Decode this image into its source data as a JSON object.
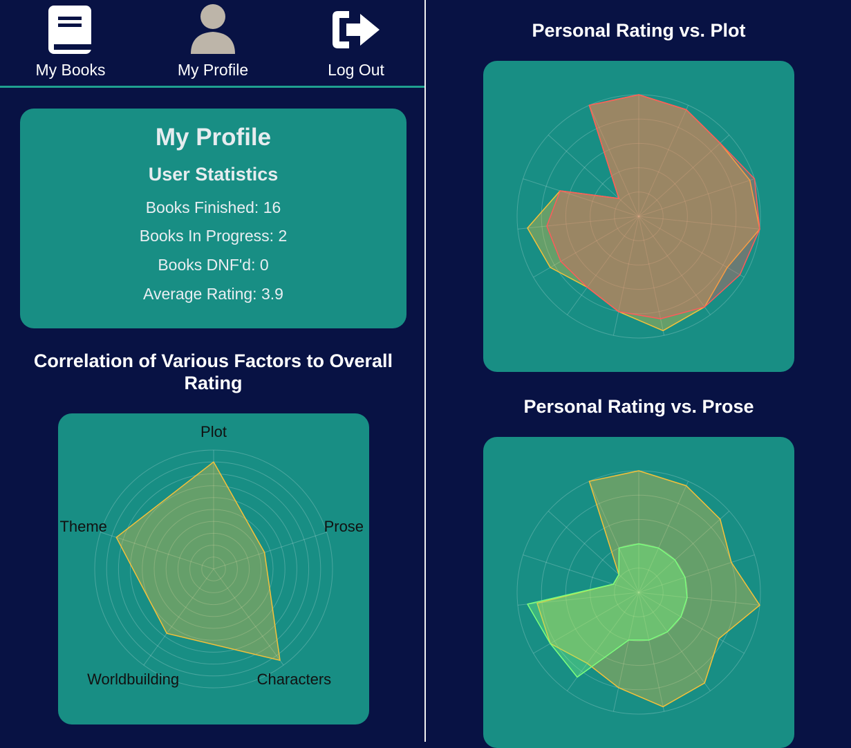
{
  "nav": {
    "items": [
      {
        "label": "My Books",
        "icon": "book-icon"
      },
      {
        "label": "My Profile",
        "icon": "user-icon"
      },
      {
        "label": "Log Out",
        "icon": "logout-icon"
      }
    ]
  },
  "profile": {
    "title": "My Profile",
    "stats_title": "User Statistics",
    "stats": [
      {
        "label": "Books Finished:",
        "value": "16"
      },
      {
        "label": "Books In Progress:",
        "value": "2"
      },
      {
        "label": "Books DNF'd:",
        "value": "0"
      },
      {
        "label": "Average Rating:",
        "value": "3.9"
      }
    ]
  },
  "colors": {
    "background": "#081244",
    "card": "#188e84",
    "gold": "#f5c13a",
    "red": "#ff5a5a",
    "green": "#7dff7d"
  },
  "chart_data": [
    {
      "type": "radar",
      "title": "Correlation of Various Factors to Overall Rating",
      "axes": [
        "Plot",
        "Prose",
        "Characters",
        "Worldbuilding",
        "Theme"
      ],
      "rmax": 1,
      "series": [
        {
          "values": [
            0.9,
            0.45,
            0.95,
            0.67,
            0.86
          ],
          "color": "#f5c13a"
        }
      ]
    },
    {
      "type": "radar",
      "title": "Personal Rating vs. Plot",
      "rmax": 5,
      "series": [
        {
          "values": [
            5,
            4.8,
            4.5,
            4.8,
            5,
            4.2,
            4.6,
            4.8,
            4.0,
            3.6,
            4.2,
            4.6,
            3.4,
            1.1,
            5
          ],
          "color": "#f5c13a"
        },
        {
          "values": [
            5,
            4.8,
            4.5,
            5,
            5,
            4.8,
            4.6,
            4.3,
            4.0,
            3.6,
            3.7,
            3.8,
            3.4,
            1.1,
            5
          ],
          "color": "#ff5a5a"
        }
      ]
    },
    {
      "type": "radar",
      "title": "Personal Rating vs. Prose",
      "rmax": 5,
      "series": [
        {
          "values": [
            5,
            4.8,
            4.5,
            4.0,
            5,
            3.8,
            4.6,
            4.8,
            4.0,
            3.6,
            4.2,
            4.2,
            1.1,
            1.1,
            5
          ],
          "color": "#f5c13a"
        },
        {
          "values": [
            2.0,
            2.0,
            2.0,
            2.0,
            2.0,
            2.0,
            2.0,
            2.0,
            2.0,
            4.3,
            4.2,
            4.6,
            1.1,
            1.1,
            2.0
          ],
          "color": "#7dff7d"
        }
      ]
    }
  ]
}
